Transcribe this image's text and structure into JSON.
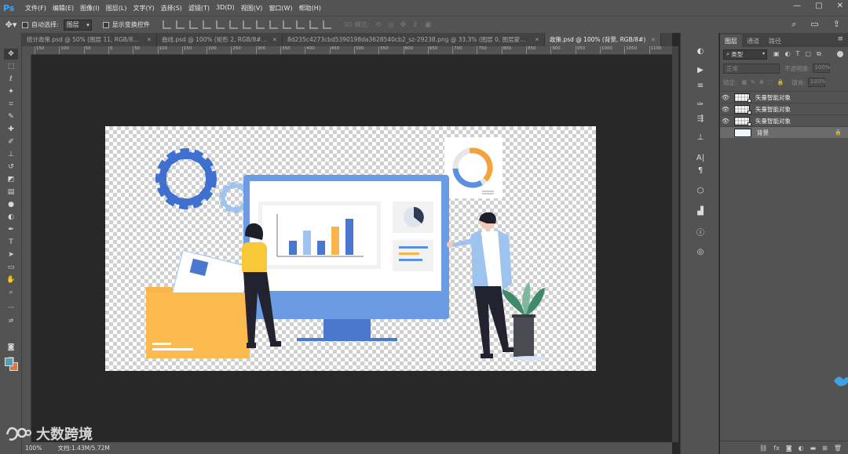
{
  "app": {
    "logo": "Ps"
  },
  "menu": [
    "文件(F)",
    "编辑(E)",
    "图像(I)",
    "图层(L)",
    "文字(Y)",
    "选择(S)",
    "滤镜(T)",
    "3D(D)",
    "视图(V)",
    "窗口(W)",
    "帮助(H)"
  ],
  "window_controls": {
    "minimize": "—",
    "maximize": "▢",
    "close": "✕"
  },
  "options": {
    "auto_select_label": "自动选择:",
    "auto_select_value": "图层",
    "show_transform_label": "显示变换控件",
    "mode_3d_label": "3D 模式:"
  },
  "tabs": [
    {
      "label": "统计政策.psd @ 50% (图层 11, RGB/8#)...",
      "active": false
    },
    {
      "label": "曲线.psd @ 100% (矩形 2, RGB/8#)...",
      "active": false
    },
    {
      "label": "8d235c4273cbd5390198da3628540cb2_sz-29238.png @ 33.3% (图层 0, 图层蒙版/8...",
      "active": false
    },
    {
      "label": "政策.psd @ 100% (背景, RGB/8#)",
      "active": true
    }
  ],
  "tab_close": "✕",
  "ruler_ticks": [
    "150",
    "100",
    "50",
    "0",
    "50",
    "100",
    "150",
    "200",
    "250",
    "300",
    "350",
    "400",
    "450",
    "500",
    "550",
    "600",
    "650",
    "700",
    "750",
    "800",
    "850",
    "900",
    "950",
    "1000",
    "1050",
    "1100"
  ],
  "status": {
    "zoom": "100%",
    "info": "文档:1.43M/5.72M"
  },
  "layers_panel": {
    "tabs": [
      "图层",
      "通道",
      "路径"
    ],
    "filter_label": "类型",
    "blend_mode": "正常",
    "opacity_label": "不透明度:",
    "opacity_value": "100%",
    "lock_label": "锁定:",
    "fill_label": "填充:",
    "fill_value": "100%",
    "layers": [
      {
        "name": "矢量智能对象",
        "visible": true,
        "selected": false,
        "locked": false
      },
      {
        "name": "矢量智能对象",
        "visible": true,
        "selected": false,
        "locked": false
      },
      {
        "name": "矢量智能对象",
        "visible": true,
        "selected": false,
        "locked": false
      },
      {
        "name": "背景",
        "visible": false,
        "selected": true,
        "locked": true
      }
    ]
  },
  "watermark": "大数跨境",
  "colors": {
    "accent": "#31a8ff",
    "foreground_swatch": "#4d9fc0",
    "background_swatch": "#e4733c",
    "illustration_blue": "#5b8fdf",
    "illustration_orange": "#f9b44b"
  }
}
